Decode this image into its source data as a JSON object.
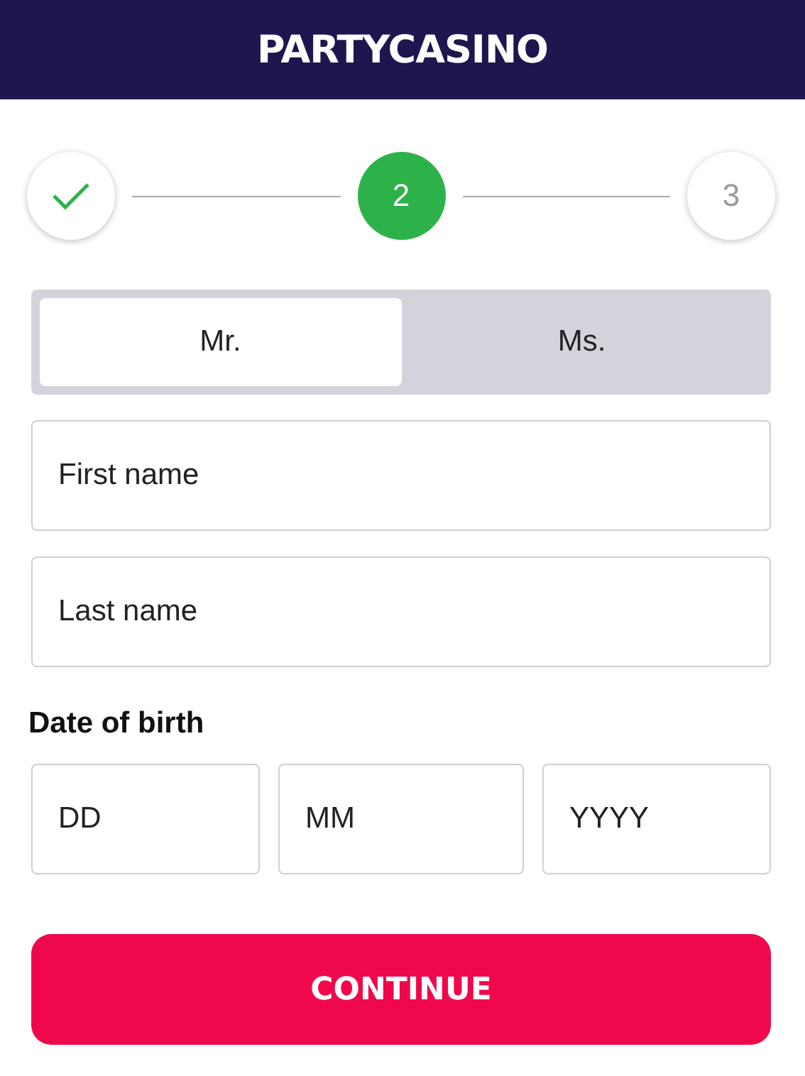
{
  "header": {
    "logo": "PARTYCASINO"
  },
  "steps": [
    {
      "done": true,
      "selected": false
    },
    {
      "done": false,
      "selected": true,
      "label": "2"
    },
    {
      "done": false,
      "selected": false,
      "label": "3"
    }
  ],
  "salutation": [
    {
      "label": "Mr.",
      "selected": true
    },
    {
      "label": "Ms.",
      "selected": false
    }
  ],
  "fields": [
    {
      "placeholder": "First name"
    },
    {
      "placeholder": "Last name"
    }
  ],
  "date_of_birth": {
    "label": "Date of birth",
    "fields": [
      {
        "placeholder": "DD"
      },
      {
        "placeholder": "MM"
      },
      {
        "placeholder": "YYYY"
      }
    ]
  },
  "button": "CONTINUE"
}
